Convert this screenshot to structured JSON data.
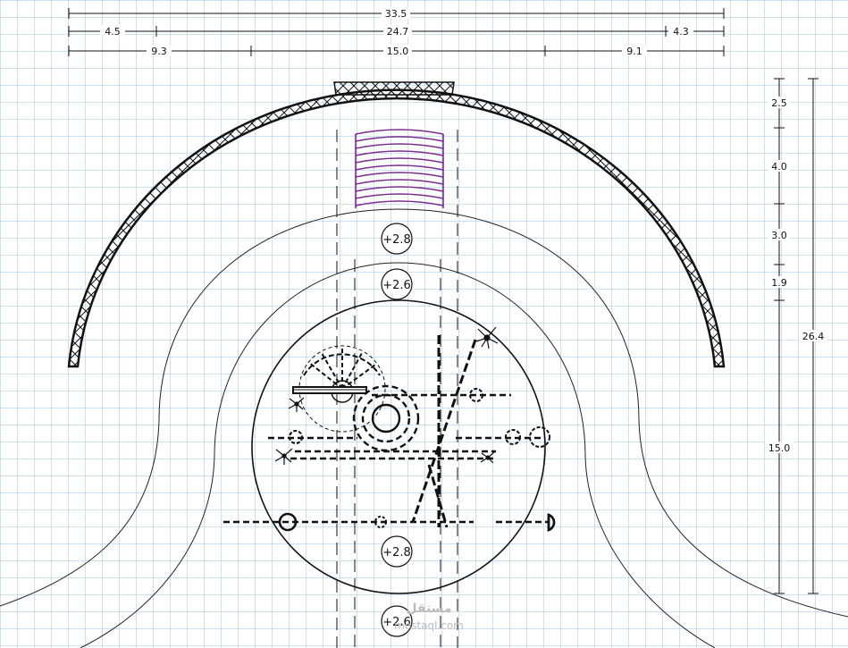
{
  "dimensions": {
    "top": {
      "overall": "33.5",
      "row2": [
        "4.5",
        "24.7",
        "4.3"
      ],
      "row3": [
        "9.3",
        "15.0",
        "9.1"
      ]
    },
    "right": {
      "segments": [
        "2.5",
        "4.0",
        "3.0",
        "1.9",
        "15.0"
      ],
      "overall": "26.4"
    }
  },
  "levels": [
    "+2.8",
    "+2.6",
    "+2.8",
    "+2.6"
  ],
  "watermark": {
    "logo": "مستقل",
    "url": "mostaql.com"
  },
  "colors": {
    "grid": "#9ec3e6",
    "line": "#111111",
    "pergola": "#7a2d8c"
  },
  "icons": [
    "plant-icon",
    "palm-icon",
    "sun-umbrella-icon"
  ]
}
